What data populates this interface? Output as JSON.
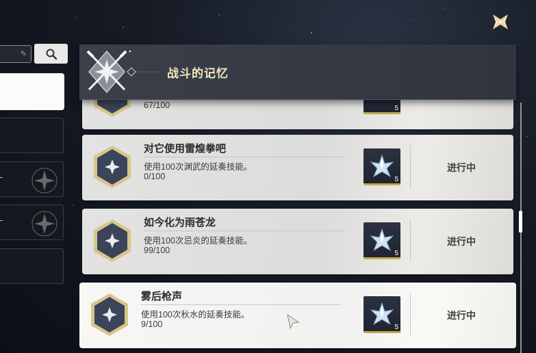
{
  "header": {
    "title": "战斗的记忆"
  },
  "top_card_partial": {
    "progress": "67/100",
    "reward_count": "5"
  },
  "achievements": [
    {
      "title": "对它使用雷煌拳吧",
      "description": "使用100次渊武的延奏技能。",
      "progress": "0/100",
      "reward_count": "5",
      "status": "进行中"
    },
    {
      "title": "如今化为雨苍龙",
      "description": "使用100次忌炎的延奏技能。",
      "progress": "99/100",
      "reward_count": "5",
      "status": "进行中"
    },
    {
      "title": "雾后枪声",
      "description": "使用100次秋水的延奏技能。",
      "progress": "9/100",
      "reward_count": "5",
      "status": "进行中"
    }
  ],
  "icons": {
    "close": "close-icon",
    "search": "search-icon",
    "edit": "edit-icon",
    "badge": "achievement-star-badge-icon",
    "reward": "crystal-star-icon"
  },
  "colors": {
    "accent_gold": "#c7a74b",
    "header_title": "#f4e6b8",
    "badge_dark": "#3b4458"
  }
}
